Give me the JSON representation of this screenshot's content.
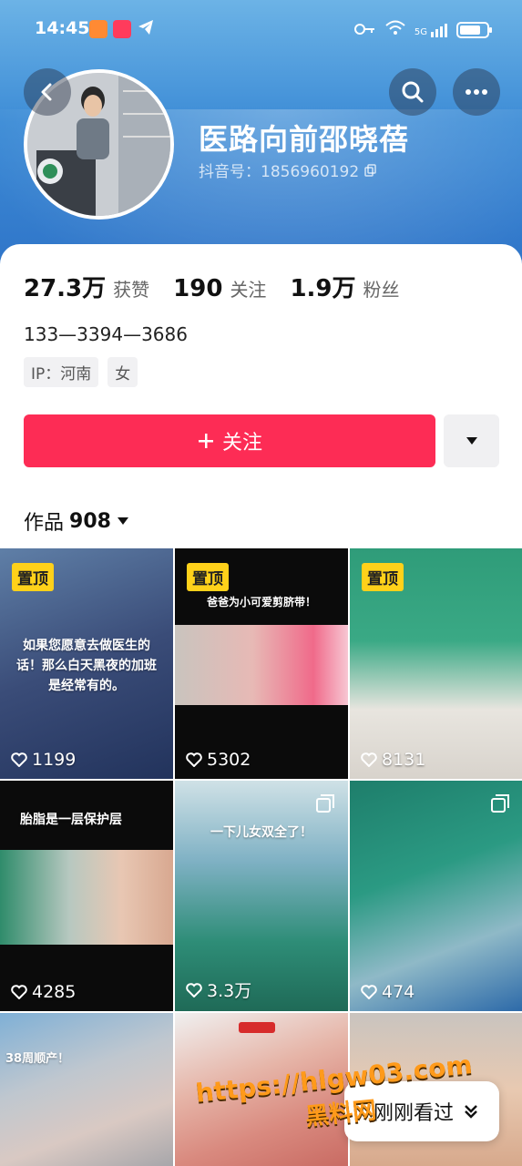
{
  "status_bar": {
    "time": "14:45",
    "network": "5G"
  },
  "header": {
    "name": "医路向前邵晓蓓",
    "douyin_id": "抖音号：1856960192"
  },
  "stats": [
    {
      "num": "27.3万",
      "label": "获赞"
    },
    {
      "num": "190",
      "label": "关注"
    },
    {
      "num": "1.9万",
      "label": "粉丝"
    }
  ],
  "bio": "133—3394—3686",
  "tags": [
    "IP：河南",
    "女"
  ],
  "follow_label": "关注",
  "works": {
    "label": "作品",
    "count": "908"
  },
  "tiles": [
    {
      "pin": "置顶",
      "caption": "如果您愿意去做医生的话！那么白天黑夜的加班是经常有的。",
      "likes": "1199"
    },
    {
      "pin": "置顶",
      "caption": "爸爸为小可爱剪脐带！",
      "likes": "5302"
    },
    {
      "pin": "置顶",
      "caption": "",
      "likes": "8131"
    },
    {
      "pin": "",
      "caption": "胎脂是一层保护层",
      "likes": "4285"
    },
    {
      "pin": "",
      "caption": "一下儿女双全了！",
      "likes": "3.3万"
    },
    {
      "pin": "",
      "caption": "",
      "likes": "474"
    },
    {
      "pin": "",
      "caption": "38周顺产！",
      "likes": ""
    },
    {
      "pin": "",
      "caption": "",
      "likes": ""
    },
    {
      "pin": "",
      "caption": "",
      "likes": ""
    }
  ],
  "recent_label": "刚刚看过",
  "watermark": {
    "line1": "https://hlgw03.com",
    "line2": "黑料网"
  },
  "colors": {
    "accent": "#fd2c55",
    "pin": "#ffd11a",
    "header": "#3d8cd6"
  }
}
